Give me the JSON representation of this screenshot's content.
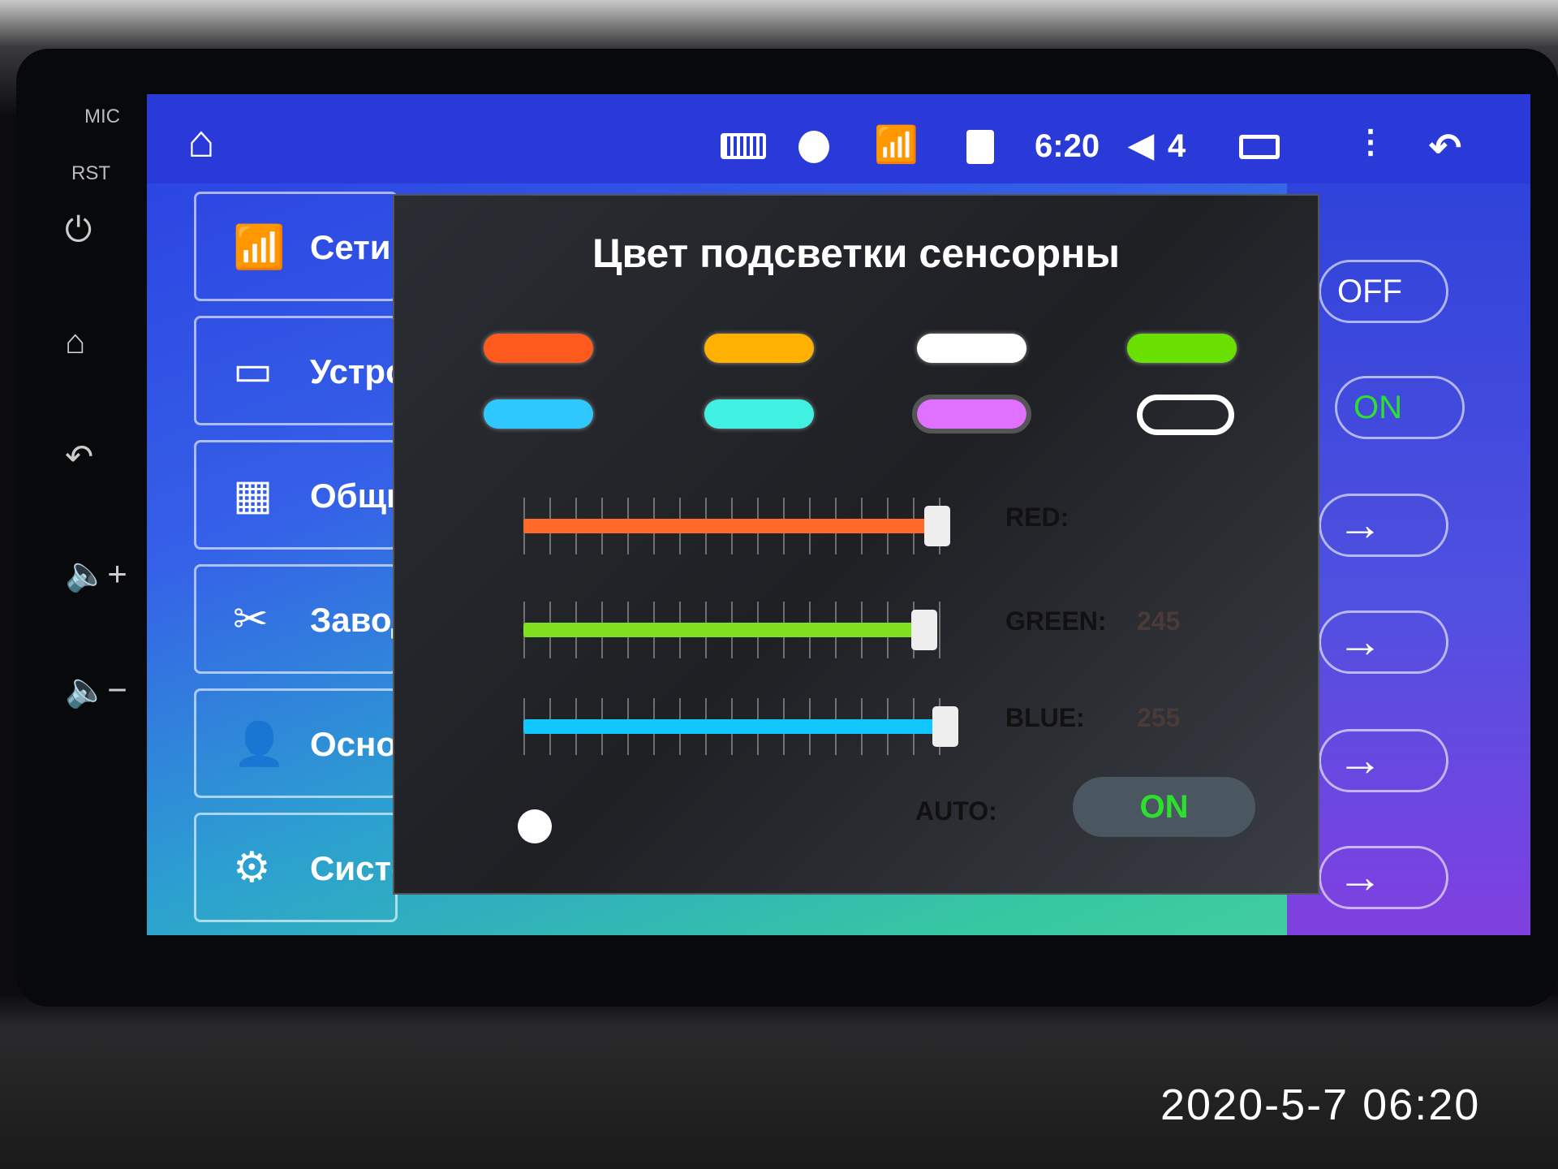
{
  "bezel": {
    "mic": "MIC",
    "rst": "RST",
    "buttons": [
      {
        "icon": "power-icon",
        "glyph": "⏻"
      },
      {
        "icon": "home-icon",
        "glyph": "⌂"
      },
      {
        "icon": "back-icon",
        "glyph": "↶"
      },
      {
        "icon": "volume-up-icon",
        "glyph": "🔈+"
      },
      {
        "icon": "volume-down-icon",
        "glyph": "🔈−"
      }
    ]
  },
  "status_bar": {
    "time": "6:20",
    "volume": "4"
  },
  "sidebar": {
    "items": [
      {
        "label": "Сети",
        "icon": "wifi-icon",
        "glyph": "📶"
      },
      {
        "label": "Устройство",
        "icon": "device-icon",
        "glyph": "▭"
      },
      {
        "label": "Общие",
        "icon": "grid-icon",
        "glyph": "▦"
      },
      {
        "label": "Заводские",
        "icon": "tools-icon",
        "glyph": "✂"
      },
      {
        "label": "Основные",
        "icon": "user-icon",
        "glyph": "👤"
      },
      {
        "label": "Система",
        "icon": "gear-icon",
        "glyph": "⚙"
      }
    ]
  },
  "right_column": {
    "off": "OFF",
    "on": "ON",
    "arrow": "→"
  },
  "dialog": {
    "title": "Цвет подсветки сенсорны",
    "presets": [
      {
        "color": "#ff5a1e",
        "selected": false
      },
      {
        "color": "#ffb000",
        "selected": false
      },
      {
        "color": "#ffffff",
        "selected": false
      },
      {
        "color": "#6ae000",
        "selected": false
      },
      {
        "color": "#2ec8ff",
        "selected": false
      },
      {
        "color": "#40f0e0",
        "selected": false
      },
      {
        "color": "#e070ff",
        "selected": true
      }
    ],
    "cycle_icon": "repeat-icon",
    "sliders": [
      {
        "label": "RED:",
        "value": "",
        "color": "#ff6a2a",
        "level": 0.98
      },
      {
        "label": "GREEN:",
        "value": "245",
        "color": "#80e020",
        "level": 0.95
      },
      {
        "label": "BLUE:",
        "value": "255",
        "color": "#10c8ff",
        "level": 1.0
      }
    ],
    "auto_label": "AUTO:",
    "auto_value": "ON"
  },
  "timestamp": "2020-5-7 06:20",
  "colors": {
    "accent_green": "#2ee02e",
    "status_bar": "#2a3ad8"
  }
}
